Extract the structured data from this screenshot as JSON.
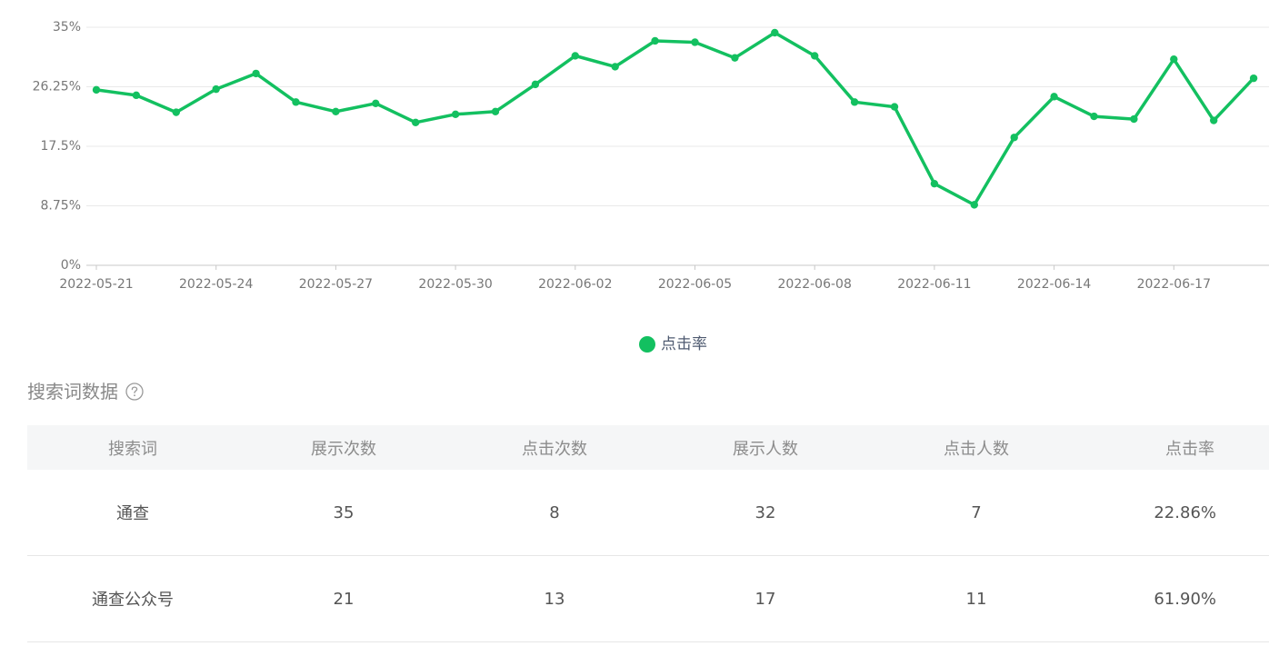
{
  "chart_data": {
    "type": "line",
    "x": [
      "2022-05-21",
      "2022-05-22",
      "2022-05-23",
      "2022-05-24",
      "2022-05-25",
      "2022-05-26",
      "2022-05-27",
      "2022-05-28",
      "2022-05-29",
      "2022-05-30",
      "2022-05-31",
      "2022-06-01",
      "2022-06-02",
      "2022-06-03",
      "2022-06-04",
      "2022-06-05",
      "2022-06-06",
      "2022-06-07",
      "2022-06-08",
      "2022-06-09",
      "2022-06-10",
      "2022-06-11",
      "2022-06-12",
      "2022-06-13",
      "2022-06-14",
      "2022-06-15",
      "2022-06-16",
      "2022-06-17",
      "2022-06-18",
      "2022-06-19"
    ],
    "x_tick_labels": [
      "2022-05-21",
      "2022-05-24",
      "2022-05-27",
      "2022-05-30",
      "2022-06-02",
      "2022-06-05",
      "2022-06-08",
      "2022-06-11",
      "2022-06-14",
      "2022-06-17"
    ],
    "series": [
      {
        "name": "点击率",
        "color": "#13c060",
        "values": [
          25.8,
          25.0,
          22.5,
          25.9,
          28.2,
          24.0,
          22.6,
          23.8,
          21.0,
          22.2,
          22.6,
          26.6,
          30.8,
          29.2,
          33.0,
          32.8,
          30.5,
          34.2,
          30.8,
          24.0,
          23.3,
          12.0,
          8.9,
          18.8,
          24.8,
          21.9,
          21.5,
          30.3,
          21.3,
          27.5
        ]
      }
    ],
    "y_tick_labels": [
      "0%",
      "8.75%",
      "17.5%",
      "26.25%",
      "35%"
    ],
    "ylim": [
      0,
      35
    ],
    "y_unit": "%",
    "grid": true,
    "legend_position": "bottom-center",
    "title": "",
    "xlabel": "",
    "ylabel": ""
  },
  "legend": {
    "label": "点击率",
    "color": "#13c060"
  },
  "section": {
    "title": "搜索词数据",
    "help_icon": "question-circle-icon"
  },
  "table": {
    "headers": [
      "搜索词",
      "展示次数",
      "点击次数",
      "展示人数",
      "点击人数",
      "点击率"
    ],
    "rows": [
      [
        "通查",
        "35",
        "8",
        "32",
        "7",
        "22.86%"
      ],
      [
        "通查公众号",
        "21",
        "13",
        "17",
        "11",
        "61.90%"
      ]
    ]
  }
}
